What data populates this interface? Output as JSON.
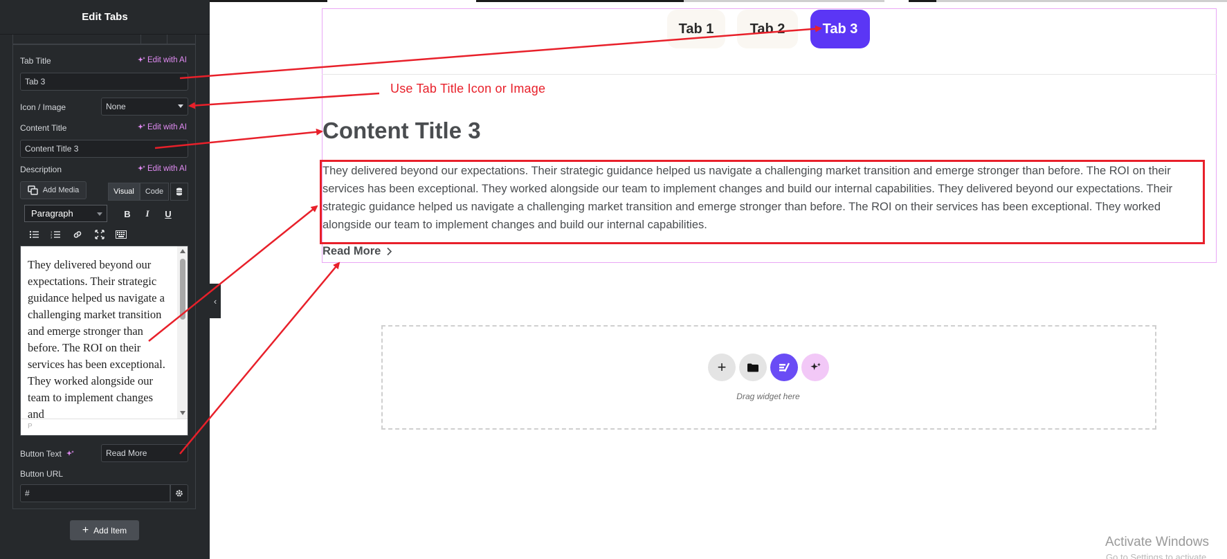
{
  "panel": {
    "title": "Edit Tabs",
    "tab_title_label": "Tab Title",
    "edit_ai": "Edit with AI",
    "tab_title_value": "Tab 3",
    "icon_image_label": "Icon / Image",
    "icon_image_value": "None",
    "content_title_label": "Content Title",
    "content_title_value": "Content Title 3",
    "description_label": "Description",
    "add_media": "Add Media",
    "tab_visual": "Visual",
    "tab_code": "Code",
    "paragraph_select": "Paragraph",
    "toolbar_bold": "B",
    "toolbar_italic": "I",
    "toolbar_underline": "U",
    "editor_text": "They delivered beyond our expectations. Their strategic guidance helped us navigate a challenging market transition and emerge stronger than before. The ROI on their services has been exceptional. They worked alongside our team to implement changes and",
    "editor_status": "P",
    "button_text_label": "Button Text",
    "button_text_value": "Read More",
    "button_url_label": "Button URL",
    "button_url_value": "#",
    "add_item": "Add Item"
  },
  "canvas": {
    "tabs": [
      {
        "label": "Tab 1",
        "active": false
      },
      {
        "label": "Tab 2",
        "active": false
      },
      {
        "label": "Tab 3",
        "active": true
      }
    ],
    "annotation": "Use Tab Title Icon or Image",
    "content_title": "Content Title 3",
    "description": "They delivered beyond our expectations. Their strategic guidance helped us navigate a challenging market transition and emerge stronger than before. The ROI on their services has been exceptional. They worked alongside our team to implement changes and build our internal capabilities. They delivered beyond our expectations. Their strategic guidance helped us navigate a challenging market transition and emerge stronger than before. The ROI on their services has been exceptional. They worked alongside our team to implement changes and build our internal capabilities.",
    "read_more": "Read More",
    "drag_widget": "Drag widget here",
    "windows_activate": "Activate Windows",
    "windows_sub": "Go to Settings to activate Windows."
  },
  "colors": {
    "panel_bg": "#26292c",
    "accent_ai": "#e38cf5",
    "active_tab": "#5b36f5",
    "annotation_red": "#e8202a"
  }
}
